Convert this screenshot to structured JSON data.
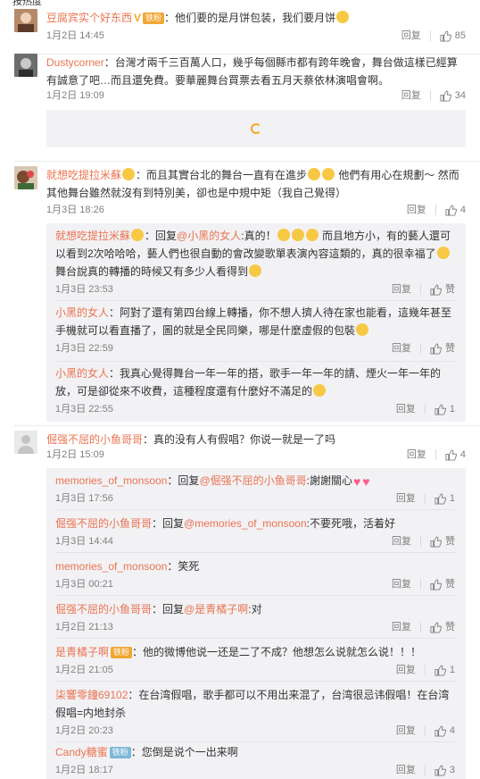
{
  "top_cut_label": "按热度",
  "reply_label": "回复",
  "like_label": "赞",
  "comments": [
    {
      "user": "豆腐宾实个好东西",
      "vip": "V",
      "badge": "铁粉",
      "text": "他们要的是月饼包装，我们要月饼",
      "time": "1月2日 14:45",
      "likes": "85"
    },
    {
      "user": "Dustycorner",
      "text": "台灣才兩千三百萬人口，幾乎每個縣市都有跨年晚會，舞台做這樣已經算有誠意了吧…而且還免費。要華麗舞台買票去看五月天蔡依林演唱會啊。",
      "time": "1月2日 19:09",
      "likes": "34"
    },
    {
      "user": "就想吃提拉米蘇",
      "text_a": "而且其實台北的舞台一直有在進步",
      "text_b": "他們有用心在規劃～ 然而其他舞台雖然就沒有到特別美，卻也是中規中矩（我自己覺得）",
      "time": "1月3日 18:26",
      "likes": "4",
      "replies": [
        {
          "user": "就想吃提拉米蘇",
          "prefix": "回复",
          "mention": "@小黑的女人",
          "text_a": "真的！",
          "text_b": "而且地方小，有的藝人還可以看到2次哈哈哈，藝人們也很自動的會改變歌單表演內容這類的，真的很幸福了",
          "text_c": "舞台說真的轉播的時候又有多少人看得到",
          "time": "1月3日 23:53",
          "likes": "赞"
        },
        {
          "user": "小黑的女人",
          "text": "阿對了還有第四台線上轉播，你不想人擠人待在家也能看，這幾年甚至手機就可以看直播了，圖的就是全民同樂，哪是什麼虛假的包裝",
          "time": "1月3日 22:59",
          "likes": "赞"
        },
        {
          "user": "小黑的女人",
          "text": "我真心覺得舞台一年一年的搭，歌手一年一年的請、煙火一年一年的放，可是卻從來不收費，這種程度還有什麼好不滿足的",
          "time": "1月3日 22:55",
          "likes": "1"
        }
      ]
    },
    {
      "user": "倔强不屈的小鱼哥哥",
      "text": "真的没有人有假唱？你说一就是一了吗",
      "time": "1月2日 15:09",
      "likes": "4",
      "replies": [
        {
          "user": "memories_of_monsoon",
          "prefix": "回复",
          "mention": "@倔强不屈的小鱼哥哥",
          "text": ":謝謝關心",
          "time": "1月3日 17:56",
          "likes": "1"
        },
        {
          "user": "倔强不屈的小鱼哥哥",
          "prefix": "回复",
          "mention": "@memories_of_monsoon",
          "text": ":不要死哦，活着好",
          "time": "1月3日 14:44",
          "likes": "赞"
        },
        {
          "user": "memories_of_monsoon",
          "text": "笑死",
          "time": "1月3日 00:21",
          "likes": "赞"
        },
        {
          "user": "倔强不屈的小鱼哥哥",
          "prefix": "回复",
          "mention": "@是青橘子啊",
          "text": ":对",
          "time": "1月2日 21:13",
          "likes": "赞"
        },
        {
          "user": "是青橘子啊",
          "badge": "铁粉",
          "text": "他的微博他说一还是二了不成？他想怎么说就怎么说！！！",
          "time": "1月2日 21:05",
          "likes": "1"
        },
        {
          "user": "柒響零鐘69102",
          "text": "在台湾假唱，歌手都可以不用出来混了，台湾很忌讳假唱！在台湾假唱=内地封杀",
          "time": "1月2日 20:23",
          "likes": "4"
        },
        {
          "user": "Candy糖蜜",
          "badge": "铁粉",
          "text": "您倒是说个一出来啊",
          "time": "1月2日 18:17",
          "likes": "3"
        }
      ]
    }
  ],
  "colors": {
    "username": "#eb7350",
    "text": "#333333",
    "meta": "#808080",
    "reply_bg": "#f2f2f5",
    "badge_gold": "#f2a634",
    "badge_teal": "#7fb7d6",
    "spinner": "#f5a623"
  }
}
